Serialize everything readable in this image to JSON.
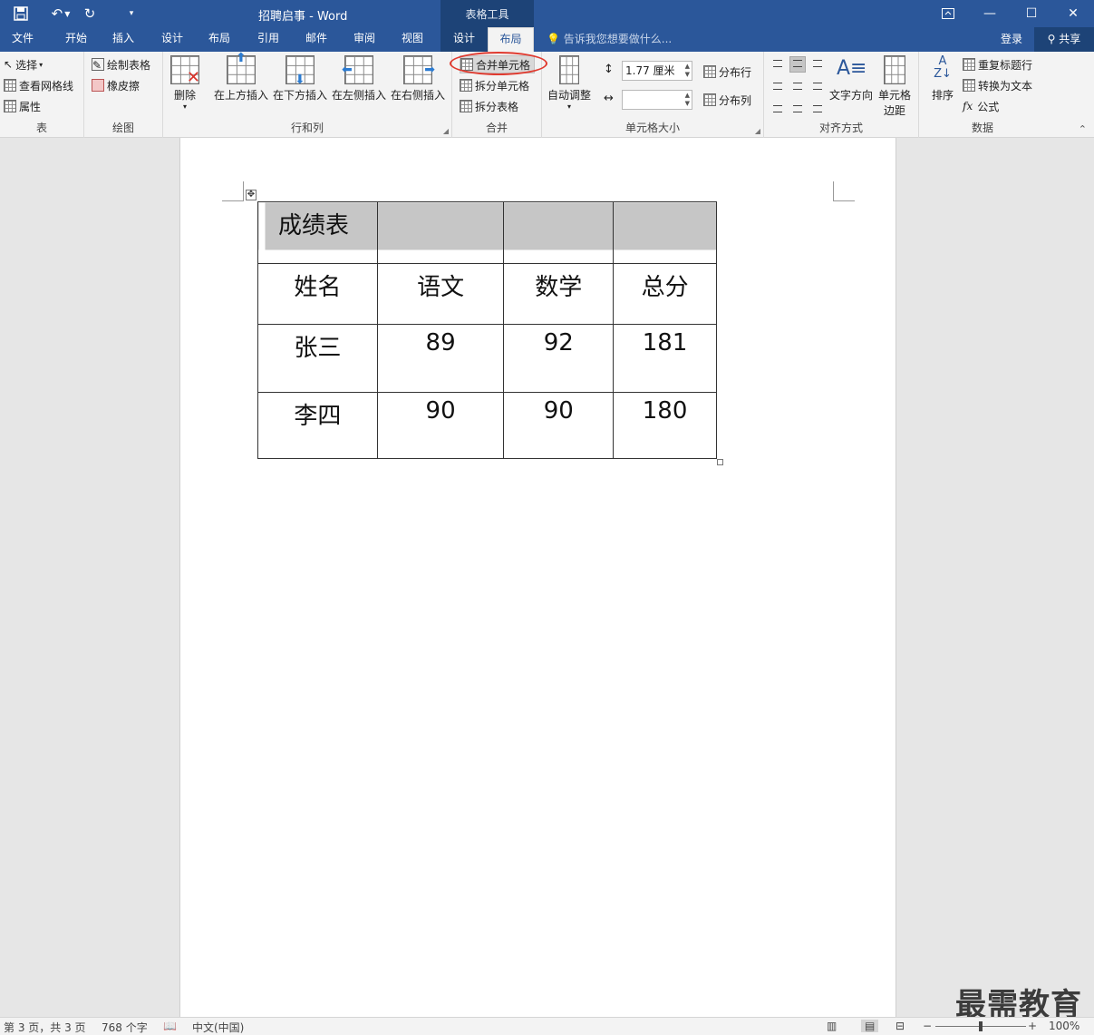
{
  "window": {
    "title": "招聘启事 - Word",
    "context_group": "表格工具",
    "controls": [
      "restore-ribbon-icon",
      "minimize-icon",
      "maximize-icon",
      "close-icon"
    ]
  },
  "qat": {
    "save": "save-icon",
    "undo": "undo-icon",
    "redo": "redo-icon",
    "customize": "customize-icon"
  },
  "tabs": {
    "file": "文件",
    "home": "开始",
    "insert": "插入",
    "design": "设计",
    "layout": "布局",
    "references": "引用",
    "mailings": "邮件",
    "review": "审阅",
    "view": "视图",
    "ctx_design": "设计",
    "ctx_layout": "布局",
    "tellme": "告诉我您想要做什么...",
    "login": "登录",
    "share": "共享"
  },
  "ribbon": {
    "table_group": {
      "label": "表",
      "select": "选择",
      "gridlines": "查看网格线",
      "properties": "属性"
    },
    "draw_group": {
      "label": "绘图",
      "draw_table": "绘制表格",
      "eraser": "橡皮擦"
    },
    "rows_cols_group": {
      "label": "行和列",
      "delete": "删除",
      "insert_above": "在上方插入",
      "insert_below": "在下方插入",
      "insert_left": "在左侧插入",
      "insert_right": "在右侧插入"
    },
    "merge_group": {
      "label": "合并",
      "merge_cells": "合并单元格",
      "split_cells": "拆分单元格",
      "split_table": "拆分表格"
    },
    "cell_size_group": {
      "label": "单元格大小",
      "autofit": "自动调整",
      "height_value": "1.77 厘米",
      "width_value": "",
      "distribute_rows": "分布行",
      "distribute_cols": "分布列"
    },
    "alignment_group": {
      "label": "对齐方式",
      "text_direction": "文字方向",
      "cell_margins_1": "单元格",
      "cell_margins_2": "边距"
    },
    "data_group": {
      "label": "数据",
      "sort": "排序",
      "repeat_header": "重复标题行",
      "convert_text": "转换为文本",
      "formula": "公式"
    }
  },
  "document": {
    "table": {
      "title": "成绩表",
      "headers": [
        "姓名",
        "语文",
        "数学",
        "总分"
      ],
      "rows": [
        [
          "张三",
          "89",
          "92",
          "181"
        ],
        [
          "李四",
          "90",
          "90",
          "180"
        ]
      ]
    }
  },
  "watermark": "最需教育",
  "status": {
    "page": "第 3 页，共 3 页",
    "words": "768 个字",
    "language": "中文(中国)",
    "zoom": "100%",
    "zoom_fraction": 0.5
  }
}
